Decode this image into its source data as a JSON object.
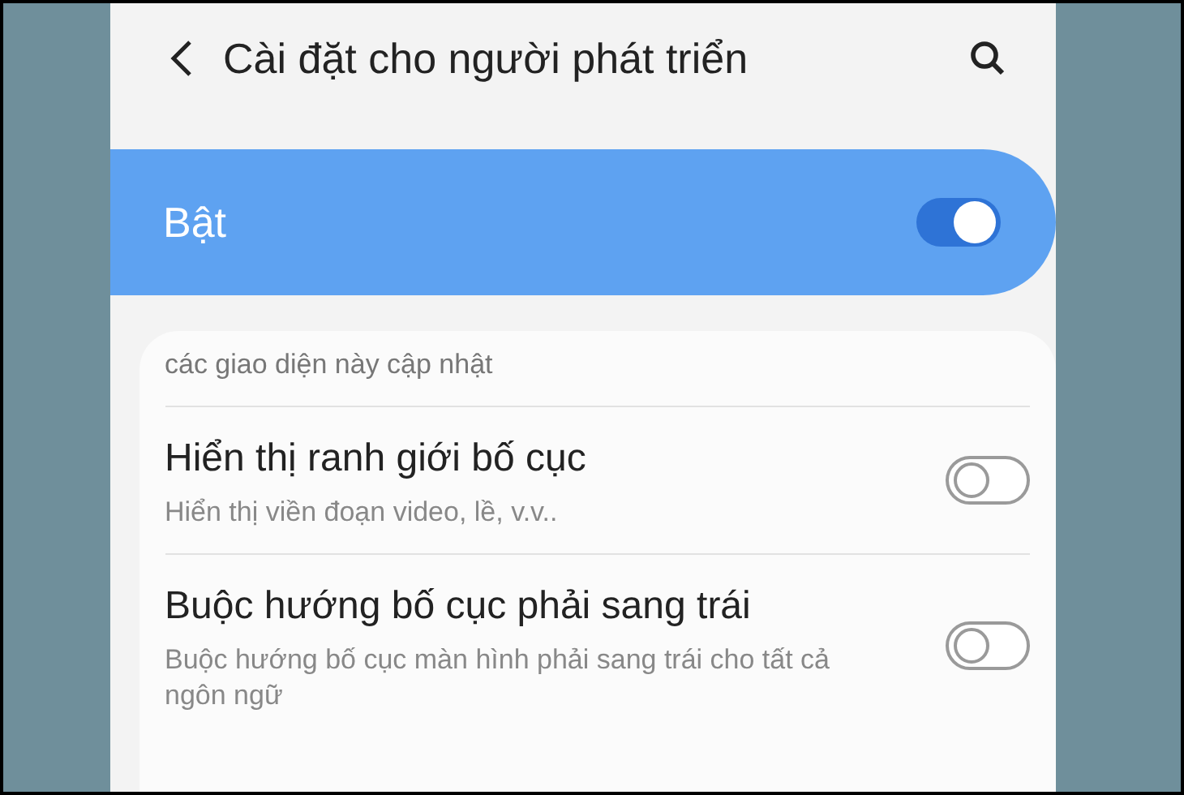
{
  "header": {
    "title": "Cài đặt cho người phát triển"
  },
  "master_switch": {
    "label": "Bật",
    "on": true
  },
  "settings": [
    {
      "kind": "tail",
      "subtitle": "các giao diện này cập nhật"
    },
    {
      "kind": "switch",
      "title": "Hiển thị ranh giới bố cục",
      "subtitle": "Hiển thị viền đoạn video, lề, v.v..",
      "on": false
    },
    {
      "kind": "switch",
      "title": "Buộc hướng bố cục phải sang trái",
      "subtitle": "Buộc hướng bố cục màn hình phải sang trái cho tất cả ngôn ngữ",
      "on": false
    }
  ]
}
